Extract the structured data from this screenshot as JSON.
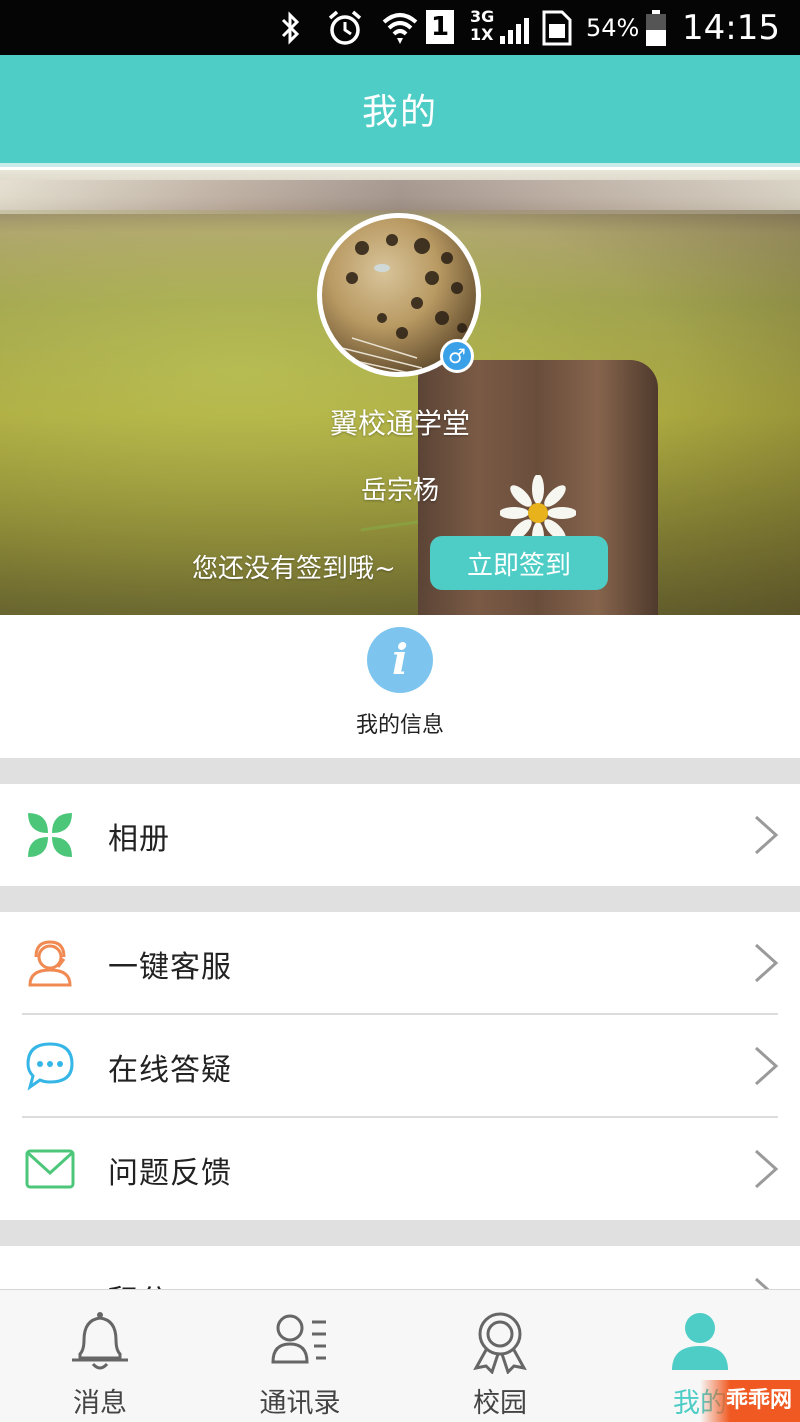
{
  "status_bar": {
    "battery_percent": "54%",
    "time": "14:15",
    "network": "3G 1X",
    "sim": "1",
    "icons": [
      "bluetooth-icon",
      "alarm-icon",
      "wifi-icon",
      "sim-icon",
      "signal-icon",
      "sim-card-icon",
      "battery-icon"
    ]
  },
  "header": {
    "title": "我的"
  },
  "profile": {
    "school": "翼校通学堂",
    "name": "岳宗杨",
    "gender_symbol": "♂",
    "signin_prompt": "您还没有签到哦~",
    "signin_button": "立即签到"
  },
  "my_info": {
    "icon_glyph": "i",
    "label": "我的信息"
  },
  "menu": {
    "album": {
      "label": "相册",
      "icon": "album-clover-icon",
      "color": "#4cc77a"
    },
    "service": {
      "label": "一键客服",
      "icon": "customer-service-icon",
      "color": "#f08a52"
    },
    "qa": {
      "label": "在线答疑",
      "icon": "chat-bubble-icon",
      "color": "#35b6e6"
    },
    "feedback": {
      "label": "问题反馈",
      "icon": "envelope-icon",
      "color": "#4cc77a"
    },
    "partial": {
      "label": "积分",
      "icon": "folder-icon",
      "color": "#f5c55a"
    }
  },
  "bottom_nav": {
    "items": [
      {
        "label": "消息",
        "icon": "bell-icon"
      },
      {
        "label": "通讯录",
        "icon": "contacts-icon"
      },
      {
        "label": "校园",
        "icon": "badge-icon"
      },
      {
        "label": "我的",
        "icon": "person-icon",
        "active": true
      }
    ]
  },
  "watermark": {
    "text": "乖乖网"
  },
  "colors": {
    "accent": "#4ecdc6",
    "divider": "#e0e0e0"
  }
}
